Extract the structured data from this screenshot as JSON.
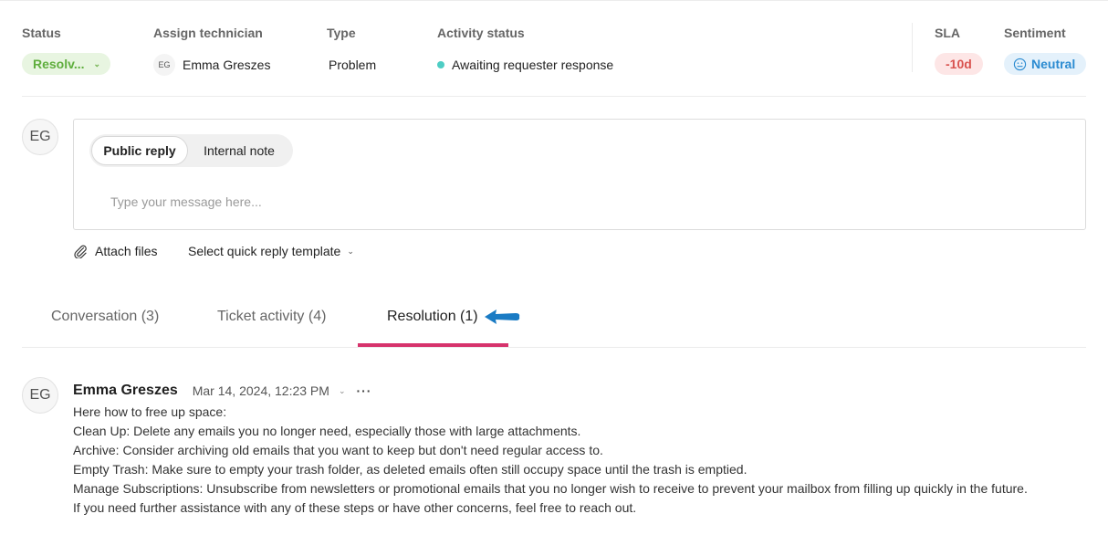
{
  "header": {
    "status": {
      "label": "Status",
      "value": "Resolv..."
    },
    "technician": {
      "label": "Assign technician",
      "initials": "EG",
      "name": "Emma Greszes"
    },
    "type": {
      "label": "Type",
      "value": "Problem"
    },
    "activity": {
      "label": "Activity status",
      "value": "Awaiting requester response",
      "dot_color": "#4ecdc4"
    },
    "sla": {
      "label": "SLA",
      "value": "-10d"
    },
    "sentiment": {
      "label": "Sentiment",
      "value": "Neutral",
      "icon": "neutral-face-icon"
    }
  },
  "composer": {
    "avatar_initials": "EG",
    "modes": [
      {
        "label": "Public reply",
        "active": true
      },
      {
        "label": "Internal note",
        "active": false
      }
    ],
    "placeholder": "Type your message here...",
    "attach_label": "Attach files",
    "template_label": "Select quick reply template"
  },
  "tabs": [
    {
      "label": "Conversation (3)",
      "active": false
    },
    {
      "label": "Ticket activity (4)",
      "active": false
    },
    {
      "label": "Resolution (1)",
      "active": true
    }
  ],
  "accent_color": "#d6336c",
  "resolution": {
    "avatar_initials": "EG",
    "author": "Emma Greszes",
    "timestamp": "Mar 14, 2024, 12:23 PM",
    "more_label": "···",
    "lines": [
      "Here how to free up space:",
      "Clean Up: Delete any emails you no longer need, especially those with large attachments.",
      "Archive: Consider archiving old emails that you want to keep but don't need regular access to.",
      "Empty Trash: Make sure to empty your trash folder, as deleted emails often still occupy space until the trash is emptied.",
      "Manage Subscriptions: Unsubscribe from newsletters or promotional emails that you no longer wish to receive to prevent your mailbox from filling up quickly in the future.",
      "If you need further assistance with any of these steps or have other concerns, feel free to reach out."
    ]
  }
}
